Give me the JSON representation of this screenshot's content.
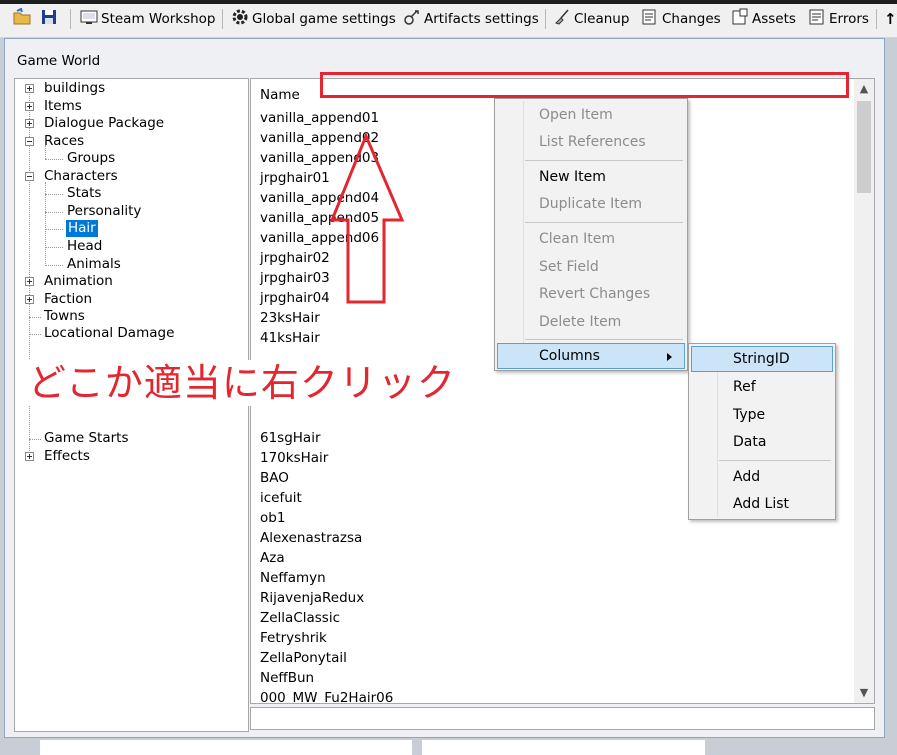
{
  "toolbar": {
    "items": [
      {
        "label": "",
        "icon": "open-folder-icon"
      },
      {
        "label": "",
        "icon": "save-icon"
      },
      {
        "label": "Steam Workshop",
        "icon": "workshop-icon"
      },
      {
        "label": "Global game settings",
        "icon": "gear-icon"
      },
      {
        "label": "Artifacts settings",
        "icon": "artifacts-icon"
      },
      {
        "label": "Cleanup",
        "icon": "broom-icon"
      },
      {
        "label": "Changes",
        "icon": "changes-icon"
      },
      {
        "label": "Assets",
        "icon": "assets-icon"
      },
      {
        "label": "Errors",
        "icon": "errors-icon"
      }
    ]
  },
  "window": {
    "title": "Game World"
  },
  "tree": {
    "items": [
      {
        "label": "buildings"
      },
      {
        "label": "Items"
      },
      {
        "label": "Dialogue Package"
      },
      {
        "label": "Races"
      },
      {
        "label": "Groups"
      },
      {
        "label": "Characters"
      },
      {
        "label": "Stats"
      },
      {
        "label": "Personality"
      },
      {
        "label": "Hair",
        "selected": true
      },
      {
        "label": "Head"
      },
      {
        "label": "Animals"
      },
      {
        "label": "Animation"
      },
      {
        "label": "Faction"
      },
      {
        "label": "Towns"
      },
      {
        "label": "Locational Damage"
      },
      {
        "label": "Game Starts"
      },
      {
        "label": "Effects"
      }
    ]
  },
  "list": {
    "header": "Name",
    "rows": [
      "vanilla_append01",
      "vanilla_append02",
      "vanilla_append03",
      "jrpghair01",
      "vanilla_append04",
      "vanilla_append05",
      "vanilla_append06",
      "jrpghair02",
      "jrpghair03",
      "jrpghair04",
      "23ksHair",
      "41ksHair",
      "61sgHair",
      "170ksHair",
      "BAO",
      "icefuit",
      "ob1",
      "Alexenastrazsa",
      "Aza",
      "Neffamyn",
      "RijavenjaRedux",
      "ZellaClassic",
      "Fetryshrik",
      "ZellaPonytail",
      "NeffBun",
      "000_MW_Fu2Hair06"
    ]
  },
  "context_menu": {
    "items": [
      "Open Item",
      "List References",
      "New Item",
      "Duplicate Item",
      "Clean Item",
      "Set Field",
      "Revert Changes",
      "Delete Item",
      "Columns"
    ]
  },
  "submenu": {
    "items": [
      "StringID",
      "Ref",
      "Type",
      "Data",
      "Add",
      "Add List"
    ]
  },
  "annotation": {
    "text": "どこか適当に右クリック",
    "color": "#e3262f"
  },
  "colors": {
    "selection": "#0078d7",
    "menu_hover": "#cce4f7",
    "annotation_red": "#e3262f"
  }
}
